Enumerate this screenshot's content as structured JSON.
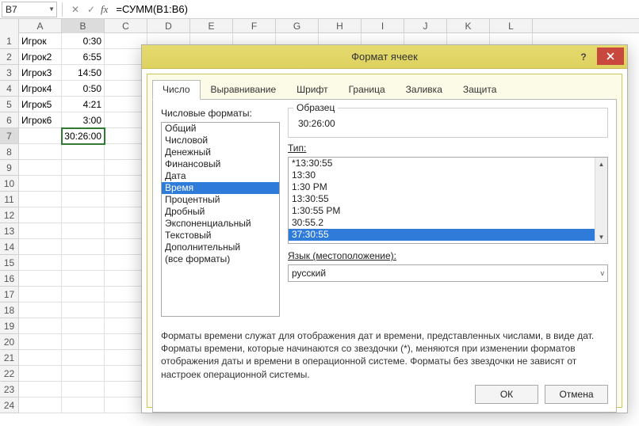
{
  "formula_bar": {
    "cell_ref": "B7",
    "fx_label": "fx",
    "formula": "=СУММ(B1:B6)"
  },
  "grid": {
    "columns": [
      "A",
      "B",
      "C",
      "D",
      "E",
      "F",
      "G",
      "H",
      "I",
      "J",
      "K",
      "L"
    ],
    "selected_col": "B",
    "selected_row": 7,
    "row_count": 24,
    "data": {
      "1": {
        "A": "Игрок",
        "B": "0:30"
      },
      "2": {
        "A": "Игрок2",
        "B": "6:55"
      },
      "3": {
        "A": "Игрок3",
        "B": "14:50"
      },
      "4": {
        "A": "Игрок4",
        "B": "0:50"
      },
      "5": {
        "A": "Игрок5",
        "B": "4:21"
      },
      "6": {
        "A": "Игрок6",
        "B": "3:00"
      },
      "7": {
        "A": "",
        "B": "30:26:00"
      }
    }
  },
  "dialog": {
    "title": "Формат ячеек",
    "tabs": [
      "Число",
      "Выравнивание",
      "Шрифт",
      "Граница",
      "Заливка",
      "Защита"
    ],
    "active_tab": 0,
    "left_label": "Числовые форматы:",
    "categories": [
      "Общий",
      "Числовой",
      "Денежный",
      "Финансовый",
      "Дата",
      "Время",
      "Процентный",
      "Дробный",
      "Экспоненциальный",
      "Текстовый",
      "Дополнительный",
      "(все форматы)"
    ],
    "selected_category": 5,
    "sample_label": "Образец",
    "sample_value": "30:26:00",
    "type_label": "Тип:",
    "types": [
      "*13:30:55",
      "13:30",
      "1:30 PM",
      "13:30:55",
      "1:30:55 PM",
      "30:55.2",
      "37:30:55"
    ],
    "selected_type": 6,
    "lang_label": "Язык (местоположение):",
    "lang_value": "русский",
    "description": "Форматы времени служат для отображения дат и времени, представленных числами, в виде дат. Форматы времени, которые начинаются со звездочки (*), меняются при изменении форматов отображения даты и времени в операционной системе. Форматы без звездочки не зависят от настроек операционной системы.",
    "ok": "ОК",
    "cancel": "Отмена",
    "help": "?"
  }
}
